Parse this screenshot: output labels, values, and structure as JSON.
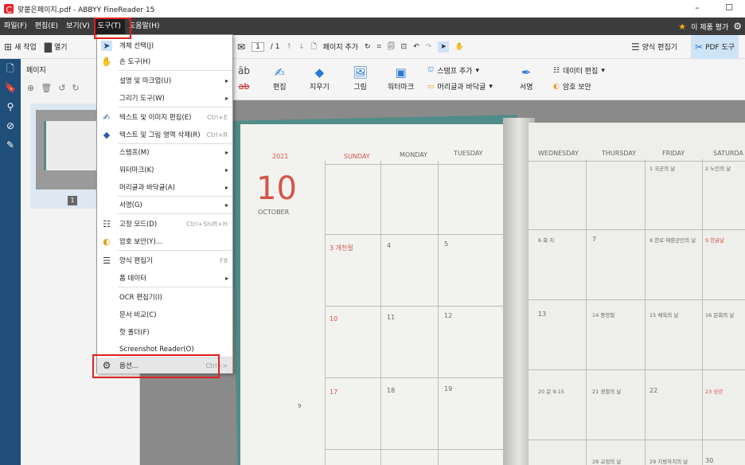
{
  "window": {
    "title": "맞붙은페이지.pdf - ABBYY FineReader 15",
    "min": "–",
    "max": "☐"
  },
  "menubar": {
    "items": [
      "파일(F)",
      "편집(E)",
      "보기(V)",
      "도구(T)",
      "도움말(H)"
    ],
    "rate": "이 제품 평가"
  },
  "toolbar": {
    "new_task": "새 작업",
    "open": "열기",
    "page_current": "1",
    "page_total": "/ 1",
    "add_page": "페이지 추가",
    "form_editor": "양식 편집기",
    "pdf_tools": "PDF 도구"
  },
  "ribbon": {
    "edit": "편집",
    "erase": "지우기",
    "image": "그림",
    "watermark": "워터마크",
    "stamp_add": "스탬프 추가",
    "header_footer": "머리글과 바닥글",
    "sign": "서명",
    "data_edit": "데이터 편집",
    "password": "암호 보안"
  },
  "pages_panel": {
    "title": "페이지",
    "thumb_num": "1"
  },
  "dropdown": {
    "items": [
      {
        "label": "개체 선택(J)",
        "shortcut": "",
        "icon": "cursor-icon"
      },
      {
        "label": "손 도구(H)",
        "shortcut": "",
        "icon": "hand-icon"
      },
      {
        "label": "설명 및 마크업(U)",
        "shortcut": "",
        "arrow": "▸"
      },
      {
        "label": "그리기 도구(W)",
        "shortcut": "",
        "arrow": "▸"
      },
      {
        "label": "텍스트 및 이미지 편집(E)",
        "shortcut": "Ctrl+E"
      },
      {
        "label": "텍스트 및 그림 영역 삭제(R)",
        "shortcut": "Ctrl+R"
      },
      {
        "label": "스탬프(M)",
        "shortcut": "",
        "arrow": "▸"
      },
      {
        "label": "워터마크(K)",
        "shortcut": "",
        "arrow": "▸"
      },
      {
        "label": "머리글과 바닥글(A)",
        "shortcut": "",
        "arrow": "▸"
      },
      {
        "label": "서명(G)",
        "shortcut": "",
        "arrow": "▸"
      },
      {
        "label": "고정 모드(D)",
        "shortcut": "Ctrl+Shift+H"
      },
      {
        "label": "암호 보안(Y)...",
        "shortcut": ""
      },
      {
        "label": "양식 편집기",
        "shortcut": "F8"
      },
      {
        "label": "폼 데이터",
        "shortcut": "",
        "arrow": "▸"
      },
      {
        "label": "OCR 편집기(I)",
        "shortcut": ""
      },
      {
        "label": "문서 비교(C)",
        "shortcut": ""
      },
      {
        "label": "핫 폴더(F)",
        "shortcut": ""
      },
      {
        "label": "Screenshot Reader(O)",
        "shortcut": ""
      },
      {
        "label": "옵션...",
        "shortcut": "Ctrl+>"
      }
    ]
  },
  "calendar": {
    "year": "2021",
    "month_num": "10",
    "month_name": "OCTOBER",
    "days_left": [
      "SUNDAY",
      "MONDAY",
      "TUESDAY"
    ],
    "days_right": [
      "WEDNESDAY",
      "THURSDAY",
      "FRIDAY",
      "SATURDA"
    ],
    "cells": [
      "1 국군의 날",
      "2 노인의 날",
      "3 개천절",
      "4",
      "5",
      "6 화 지",
      "7",
      "8 한로·재향군인의 날",
      "9 한글날",
      "10",
      "11",
      "12",
      "13",
      "14 중양절",
      "15 체육의 날",
      "16 문화의 날",
      "17",
      "18",
      "19",
      "20 문 9:15",
      "21 경찰의 날",
      "22",
      "23 상강",
      "28 교정의 날",
      "29 지방자치의 날",
      "30"
    ],
    "mini_month": "9"
  }
}
